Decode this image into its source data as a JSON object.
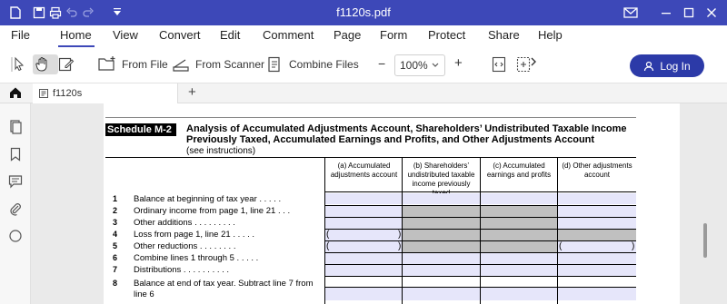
{
  "window": {
    "title": "f1120s.pdf"
  },
  "menu": {
    "items": [
      "File",
      "Home",
      "View",
      "Convert",
      "Edit",
      "Comment",
      "Page",
      "Form",
      "Protect",
      "Share",
      "Help"
    ],
    "active": "Home"
  },
  "toolbar": {
    "from_file": "From File",
    "from_scanner": "From Scanner",
    "combine_files": "Combine Files",
    "zoom": "100%",
    "zoom_minus": "−",
    "zoom_plus": "+",
    "login": "Log In"
  },
  "tabs": {
    "doc_tab": "f1120s",
    "add": "+"
  },
  "form": {
    "schedule_tag": "Schedule M-2",
    "title": "Analysis of Accumulated Adjustments Account, Shareholders’ Undistributed Taxable Income Previously Taxed, Accumulated Earnings and Profits, and Other Adjustments Account",
    "subtitle": "(see instructions)",
    "columns": [
      "(a) Accumulated adjustments account",
      "(b) Shareholders’ undistributed taxable income previously taxed",
      "(c) Accumulated earnings and profits",
      "(d) Other adjustments account"
    ],
    "rows": [
      {
        "num": "1",
        "label": "Balance at beginning of tax year . . . . ."
      },
      {
        "num": "2",
        "label": "Ordinary income from page 1, line 21 . . ."
      },
      {
        "num": "3",
        "label": "Other additions . . . . . . . . ."
      },
      {
        "num": "4",
        "label": "Loss from page 1, line 21 . . . . ."
      },
      {
        "num": "5",
        "label": "Other reductions . . . . . . . ."
      },
      {
        "num": "6",
        "label": "Combine lines 1 through 5 . . . . ."
      },
      {
        "num": "7",
        "label": "Distributions . . . . . . . . . ."
      },
      {
        "num": "8",
        "label": "Balance at end of tax year. Subtract line 7 from"
      },
      {
        "num": "",
        "label": "line 6"
      }
    ]
  }
}
